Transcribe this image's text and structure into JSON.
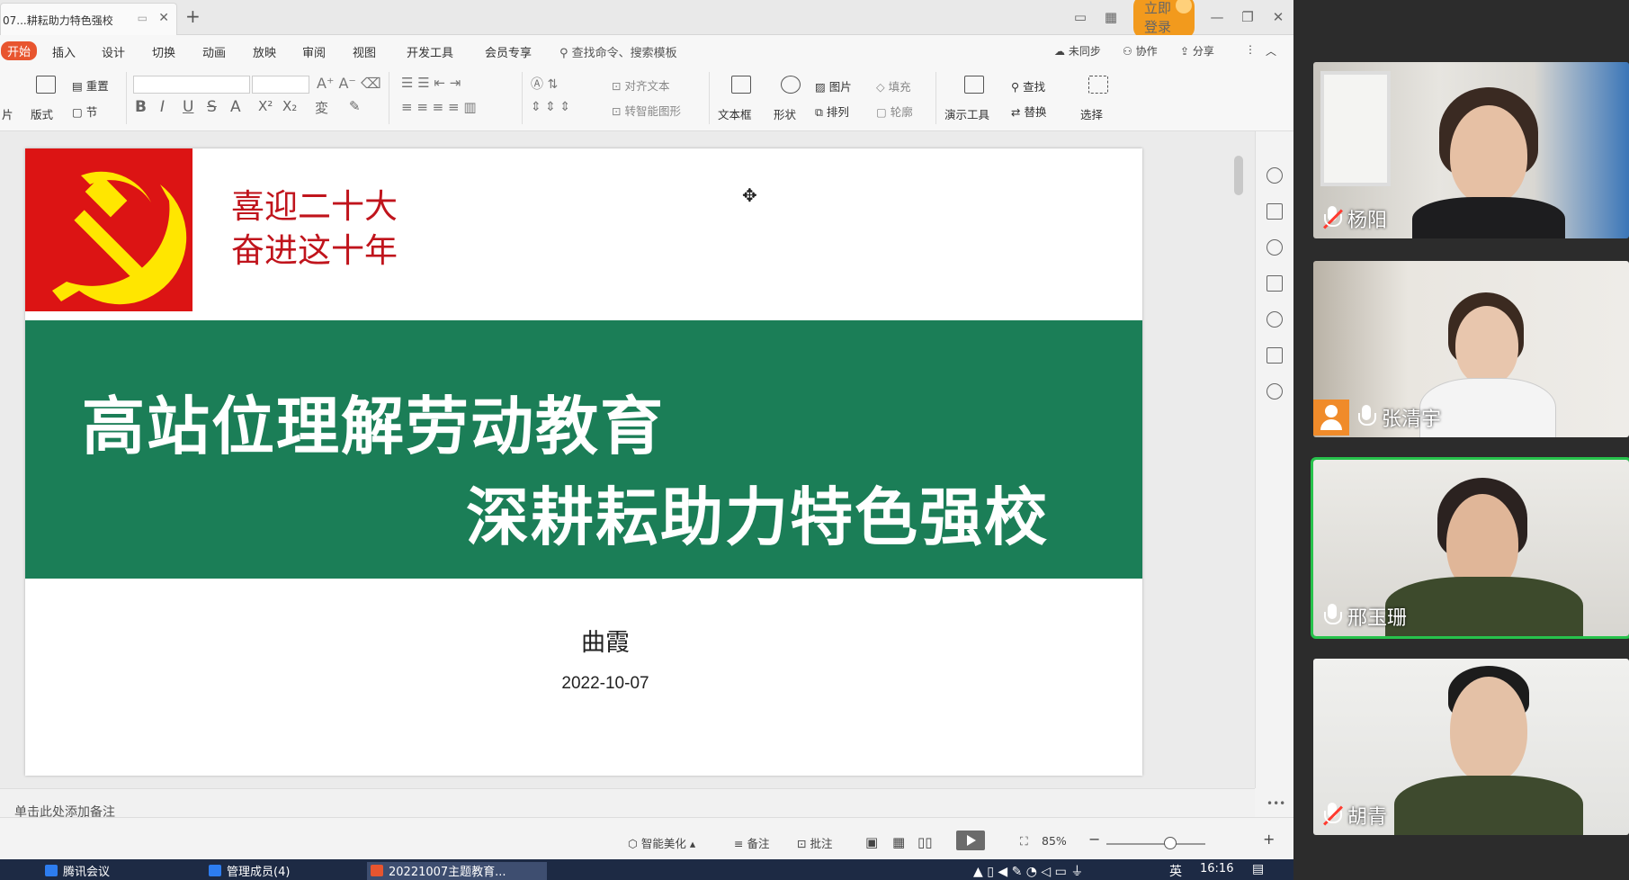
{
  "window": {
    "doc_tab_title": "07...耕耘助力特色强校",
    "login_button": "立即登录"
  },
  "ribbon": {
    "tabs": [
      "开始",
      "插入",
      "设计",
      "切换",
      "动画",
      "放映",
      "审阅",
      "视图",
      "开发工具",
      "会员专享"
    ],
    "search_placeholder": "查找命令、搜索模板",
    "right": {
      "sync": "未同步",
      "collab": "协作",
      "share": "分享"
    }
  },
  "toolbar": {
    "slide_label": "片",
    "layout": "版式",
    "reset": "重置",
    "section": "节",
    "align_text": "对齐文本",
    "smartart": "转智能图形",
    "textbox": "文本框",
    "shape": "形状",
    "picture": "图片",
    "arrange": "排列",
    "fill": "填充",
    "outline": "轮廓",
    "presentation_tools": "演示工具",
    "find": "查找",
    "replace": "替换",
    "select": "选择",
    "bold": "B",
    "italic": "I",
    "underline": "U",
    "strike": "S"
  },
  "slide": {
    "slogan_line1": "喜迎二十大",
    "slogan_line2": "奋进这十年",
    "title_line1": "高站位理解劳动教育",
    "title_line2": "深耕耘助力特色强校",
    "author": "曲霞",
    "date": "2022-10-07"
  },
  "notes_placeholder": "单击此处添加备注",
  "statusbar": {
    "beautify": "智能美化",
    "notes": "备注",
    "comments": "批注",
    "zoom": "85%"
  },
  "taskbar": {
    "items": [
      "腾讯会议",
      "管理成员(4)",
      "20221007主题教育..."
    ],
    "ime": "英",
    "time": "16:16"
  },
  "participants": [
    {
      "name": "杨阳",
      "muted": true
    },
    {
      "name": "张清宇",
      "muted": false
    },
    {
      "name": "邢玉珊",
      "muted": false,
      "speaking": true
    },
    {
      "name": "胡青",
      "muted": true
    }
  ],
  "colors": {
    "accent": "#e8552f",
    "slide_green": "#1b7e57",
    "slogan_red": "#c0141c",
    "emblem_red": "#dc1414",
    "emblem_yellow": "#ffe600",
    "speaking_border": "#27c24c"
  }
}
